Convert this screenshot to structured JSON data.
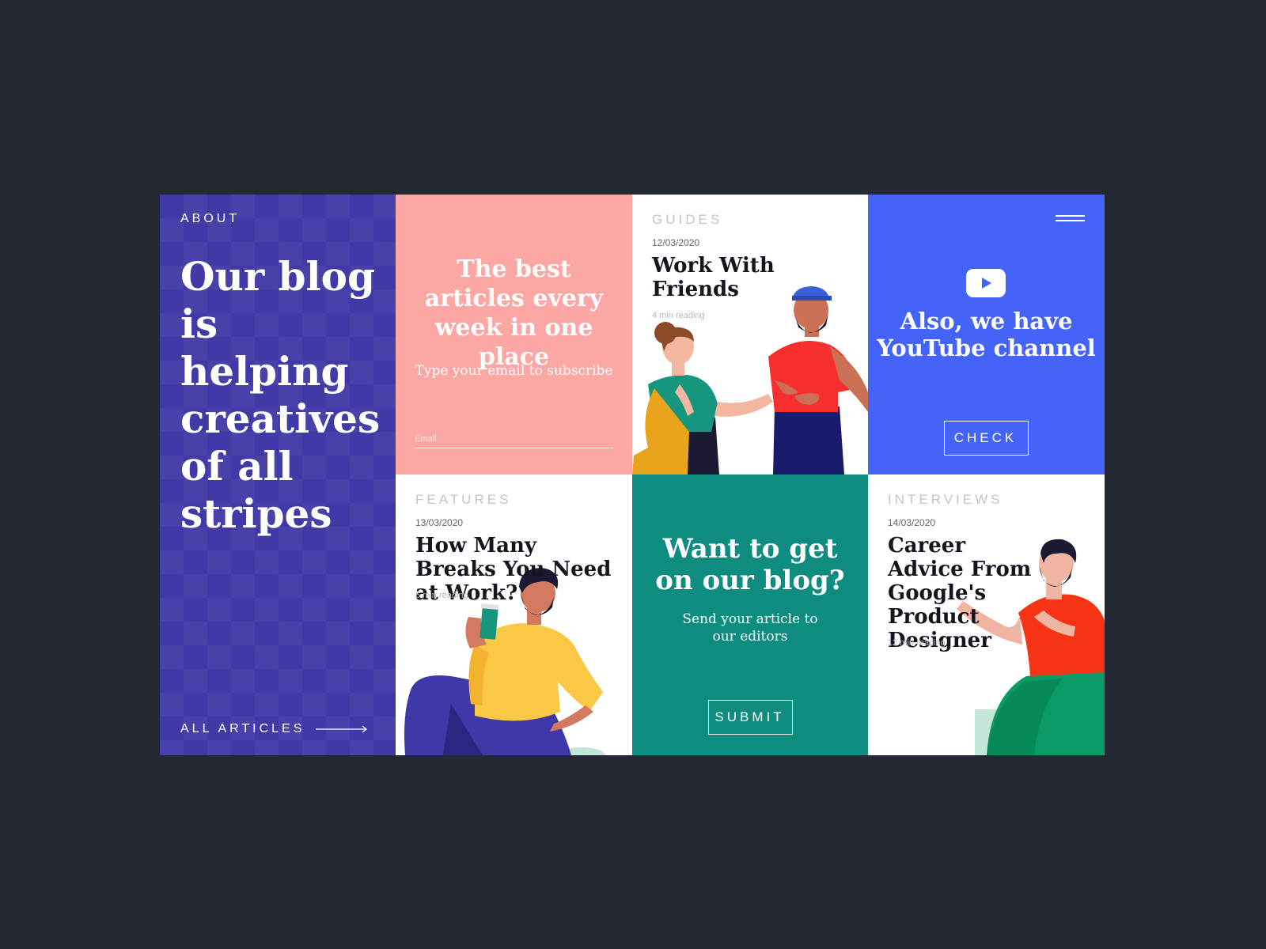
{
  "about": {
    "label": "ABOUT",
    "headline": "Our blog is helping creatives of all stripes",
    "all_articles": "ALL ARTICLES"
  },
  "subscribe": {
    "title": "The best articles every week in one place",
    "hint": "Type your email to subscribe",
    "email_placeholder": "Email"
  },
  "guides": {
    "category": "GUIDES",
    "date": "12/03/2020",
    "title": "Work With Friends",
    "reading": "4 min reading"
  },
  "youtube": {
    "icon": "youtube-play-icon",
    "title": "Also, we have YouTube channel",
    "button": "CHECK"
  },
  "features": {
    "category": "FEATURES",
    "date": "13/03/2020",
    "title": "How Many Breaks You Need at Work?",
    "reading": "6 min reading"
  },
  "contribute": {
    "title": "Want to get on our blog?",
    "subtitle": "Send your article to our editors",
    "button": "SUBMIT"
  },
  "interviews": {
    "category": "INTERVIEWS",
    "date": "14/03/2020",
    "title": "Career Advice From Google's Product Designer",
    "reading": "12 min reading"
  },
  "colors": {
    "page_bg": "#242833",
    "about_bg": "#413aa6",
    "subscribe_bg": "#fba7a3",
    "youtube_bg": "#4464f9",
    "contribute_bg": "#0e8c80",
    "card_bg": "#ffffff"
  }
}
